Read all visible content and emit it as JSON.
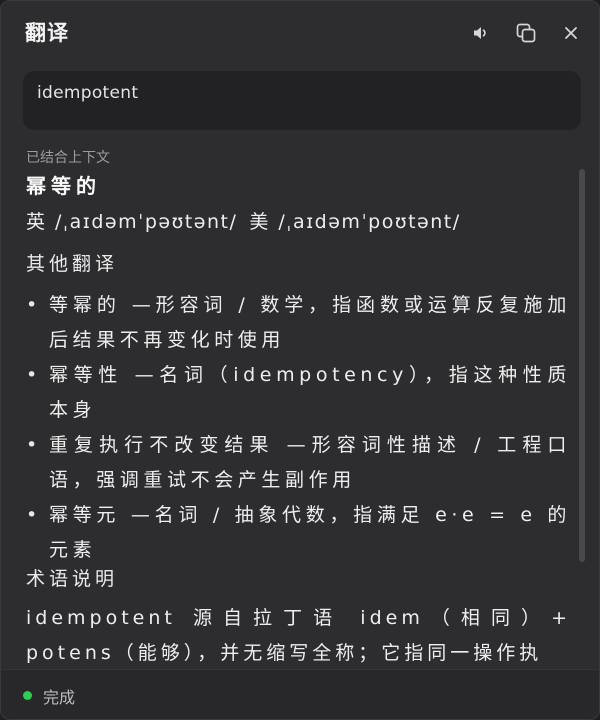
{
  "app": {
    "title": "翻译"
  },
  "titlebar": {
    "speaker_icon": "speaker-icon",
    "copy_icon": "copy-icon",
    "close_icon": "close-icon"
  },
  "input": {
    "value": "idempotent"
  },
  "result": {
    "context_note": "已结合上下文",
    "headword": "幂等的",
    "uk_label": "英",
    "uk_ipa": "/ˌaɪdəmˈpəʊtənt/",
    "us_label": "美",
    "us_ipa": "/ˌaɪdəmˈpoʊtənt/",
    "other_heading": "其他翻译",
    "other_items": [
      "等幂的 —形容词 / 数学，指函数或运算反复施加后结果不再变化时使用",
      "幂等性 —名词（idempotency），指这种性质本身",
      "重复执行不改变结果 —形容词性描述 / 工程口语，强调重试不会产生副作用",
      "幂等元 —名词 / 抽象代数，指满足 e·e = e 的元素"
    ],
    "term_heading": "术语说明",
    "term_text": "idempotent 源自拉丁语 idem（相同）+ potens（能够），并无缩写全称；它指同一操作执"
  },
  "footer": {
    "status": "完成",
    "status_color": "#2ecc52"
  }
}
